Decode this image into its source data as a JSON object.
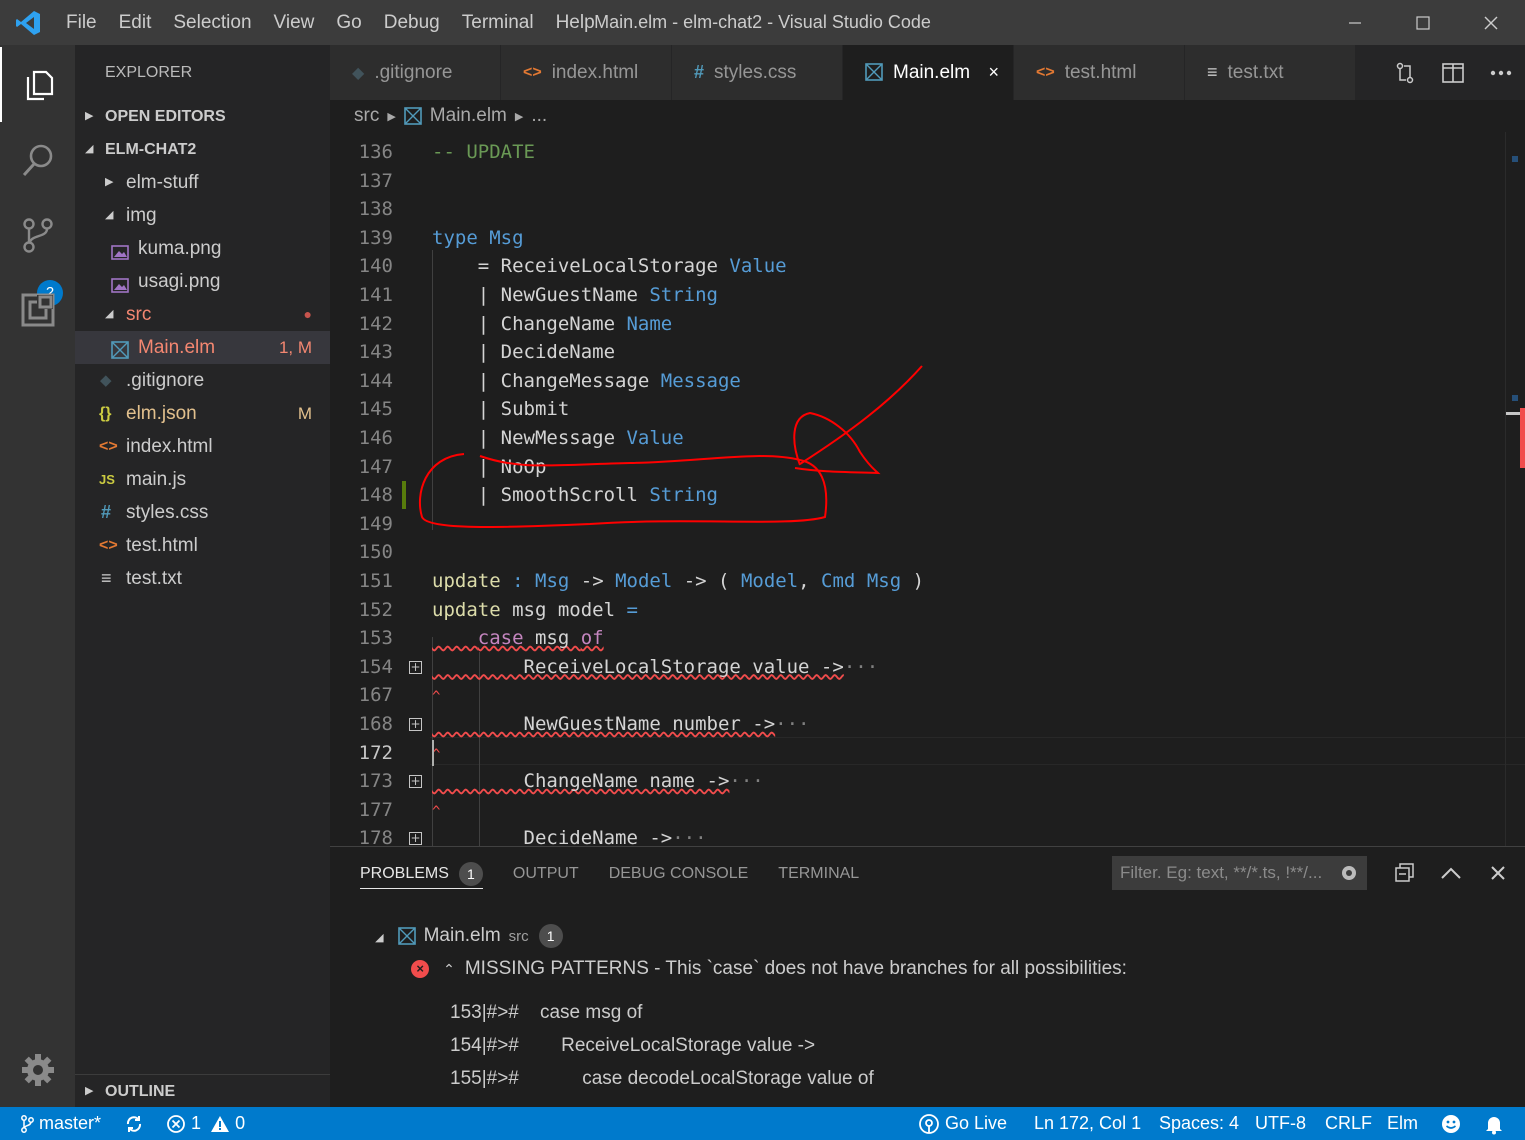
{
  "window": {
    "title": "Main.elm - elm-chat2 - Visual Studio Code",
    "menu": [
      "File",
      "Edit",
      "Selection",
      "View",
      "Go",
      "Debug",
      "Terminal",
      "Help"
    ]
  },
  "activity_bar": {
    "scm_badge": "2"
  },
  "sidebar": {
    "title": "EXPLORER",
    "open_editors": "OPEN EDITORS",
    "project": "ELM-CHAT2",
    "outline": "OUTLINE",
    "tree": [
      {
        "name": "elm-stuff",
        "icon": "folder-collapsed"
      },
      {
        "name": "img",
        "icon": "folder-expanded"
      },
      {
        "name": "kuma.png",
        "icon": "image-icon"
      },
      {
        "name": "usagi.png",
        "icon": "image-icon"
      },
      {
        "name": "src",
        "icon": "folder-expanded",
        "decoration": "●"
      },
      {
        "name": "Main.elm",
        "icon": "elm-icon",
        "decoration": "1, M"
      },
      {
        "name": ".gitignore",
        "icon": "git-icon"
      },
      {
        "name": "elm.json",
        "icon": "json-icon",
        "icon_text": "{}",
        "decoration": "M"
      },
      {
        "name": "index.html",
        "icon": "html-icon",
        "icon_text": "<>"
      },
      {
        "name": "main.js",
        "icon": "js-icon",
        "icon_text": "JS"
      },
      {
        "name": "styles.css",
        "icon": "css-icon",
        "icon_text": "#"
      },
      {
        "name": "test.html",
        "icon": "html-icon",
        "icon_text": "<>"
      },
      {
        "name": "test.txt",
        "icon": "text-icon",
        "icon_text": "≡"
      }
    ]
  },
  "tabs": [
    {
      "label": ".gitignore",
      "icon": "git-icon",
      "icon_text": "◆"
    },
    {
      "label": "index.html",
      "icon": "html-icon",
      "icon_text": "<>"
    },
    {
      "label": "styles.css",
      "icon": "css-icon",
      "icon_text": "#"
    },
    {
      "label": "Main.elm",
      "icon": "elm-icon",
      "active": true,
      "close": "×"
    },
    {
      "label": "test.html",
      "icon": "html-icon",
      "icon_text": "<>"
    },
    {
      "label": "test.txt",
      "icon": "text-icon",
      "icon_text": "≡"
    }
  ],
  "breadcrumb": {
    "folder": "src",
    "file": "Main.elm",
    "more": "..."
  },
  "editor": {
    "lines": [
      {
        "n": "136",
        "tokens": [
          [
            "cm",
            "-- UPDATE"
          ]
        ]
      },
      {
        "n": "137",
        "tokens": []
      },
      {
        "n": "138",
        "tokens": []
      },
      {
        "n": "139",
        "tokens": [
          [
            "kw",
            "type"
          ],
          [
            "pl",
            " "
          ],
          [
            "ty",
            "Msg"
          ]
        ]
      },
      {
        "n": "140",
        "tokens": [
          [
            "pl",
            "    = ReceiveLocalStorage "
          ],
          [
            "ty",
            "Value"
          ]
        ]
      },
      {
        "n": "141",
        "tokens": [
          [
            "pl",
            "    | NewGuestName "
          ],
          [
            "ty",
            "String"
          ]
        ]
      },
      {
        "n": "142",
        "tokens": [
          [
            "pl",
            "    | ChangeName "
          ],
          [
            "ty",
            "Name"
          ]
        ]
      },
      {
        "n": "143",
        "tokens": [
          [
            "pl",
            "    | DecideName"
          ]
        ]
      },
      {
        "n": "144",
        "tokens": [
          [
            "pl",
            "    | ChangeMessage "
          ],
          [
            "ty",
            "Message"
          ]
        ]
      },
      {
        "n": "145",
        "tokens": [
          [
            "pl",
            "    | Submit"
          ]
        ]
      },
      {
        "n": "146",
        "tokens": [
          [
            "pl",
            "    | NewMessage "
          ],
          [
            "ty",
            "Value"
          ]
        ]
      },
      {
        "n": "147",
        "tokens": [
          [
            "pl",
            "    | NoOp"
          ]
        ]
      },
      {
        "n": "148",
        "tokens": [
          [
            "pl",
            "    | SmoothScroll "
          ],
          [
            "ty",
            "String"
          ]
        ]
      },
      {
        "n": "149",
        "tokens": []
      },
      {
        "n": "150",
        "tokens": []
      },
      {
        "n": "151",
        "tokens": [
          [
            "fn",
            "update"
          ],
          [
            "pl",
            " "
          ],
          [
            "kw",
            ":"
          ],
          [
            "pl",
            " "
          ],
          [
            "ty",
            "Msg"
          ],
          [
            "pl",
            " -> "
          ],
          [
            "ty",
            "Model"
          ],
          [
            "pl",
            " -> ( "
          ],
          [
            "ty",
            "Model"
          ],
          [
            "pl",
            ", "
          ],
          [
            "ty",
            "Cmd"
          ],
          [
            "pl",
            " "
          ],
          [
            "ty",
            "Msg"
          ],
          [
            "pl",
            " )"
          ]
        ]
      },
      {
        "n": "152",
        "tokens": [
          [
            "fn",
            "update"
          ],
          [
            "pl",
            " msg model "
          ],
          [
            "kw",
            "="
          ]
        ]
      },
      {
        "n": "153",
        "tokens": [
          [
            "pl",
            "    "
          ],
          [
            "ctl",
            "case"
          ],
          [
            "pl",
            " msg "
          ],
          [
            "ctl",
            "of"
          ]
        ],
        "squiggle": true
      },
      {
        "n": "154",
        "tokens": [
          [
            "pl",
            "        ReceiveLocalStorage value ->"
          ],
          [
            "ell",
            "···"
          ]
        ],
        "fold": "+",
        "squiggle": true
      },
      {
        "n": "167",
        "tokens": [
          [
            "sq",
            "^"
          ]
        ]
      },
      {
        "n": "168",
        "tokens": [
          [
            "pl",
            "        NewGuestName number ->"
          ],
          [
            "ell",
            "···"
          ]
        ],
        "fold": "+",
        "squiggle": true
      },
      {
        "n": "172",
        "tokens": [
          [
            "sq",
            "^"
          ]
        ],
        "current": true
      },
      {
        "n": "173",
        "tokens": [
          [
            "pl",
            "        ChangeName name ->"
          ],
          [
            "ell",
            "···"
          ]
        ],
        "fold": "+",
        "squiggle": true
      },
      {
        "n": "177",
        "tokens": [
          [
            "sq",
            "^"
          ]
        ]
      },
      {
        "n": "178",
        "tokens": [
          [
            "pl",
            "        DecideName ->"
          ],
          [
            "ell",
            "···"
          ]
        ],
        "fold": "+",
        "squiggle": true
      }
    ]
  },
  "panel": {
    "tabs": [
      "PROBLEMS",
      "OUTPUT",
      "DEBUG CONSOLE",
      "TERMINAL"
    ],
    "problems_count": "1",
    "filter_placeholder": "Filter. Eg: text, **/*.ts, !**/...",
    "file": {
      "name": "Main.elm",
      "dir": "src",
      "count": "1"
    },
    "error": "MISSING PATTERNS - This `case` does not have branches for all possibilities:",
    "detail": [
      "153|#>#    case msg of",
      "154|#>#        ReceiveLocalStorage value ->",
      "155|#>#            case decodeLocalStorage value of"
    ]
  },
  "statusbar": {
    "branch": "master*",
    "errors": "1",
    "warnings": "0",
    "go_live": "Go Live",
    "position": "Ln 172, Col 1",
    "spaces": "Spaces: 4",
    "encoding": "UTF-8",
    "eol": "CRLF",
    "language": "Elm"
  },
  "colors": {
    "accent": "#007acc",
    "annotation": "#ff0000",
    "error": "#f14c4c"
  }
}
